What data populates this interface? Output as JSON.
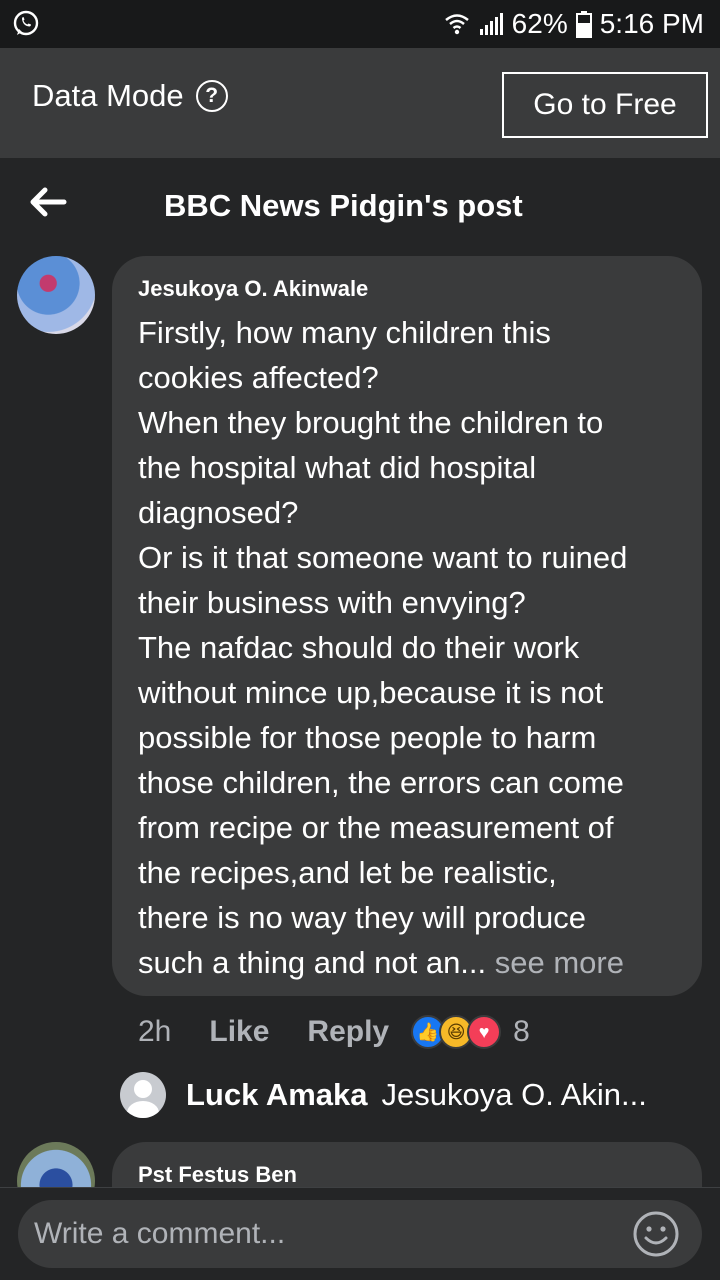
{
  "status_bar": {
    "battery": "62%",
    "time": "5:16 PM"
  },
  "data_bar": {
    "label": "Data Mode",
    "help_glyph": "?",
    "button": "Go to Free"
  },
  "header": {
    "title": "BBC News Pidgin's post"
  },
  "comment": {
    "author": "Jesukoya O. Akinwale",
    "text": "Firstly, how many children this\ncookies affected?\nWhen they brought the children to\nthe hospital what did hospital\ndiagnosed?\nOr is it that someone want to ruined\ntheir business with envying?\nThe nafdac should do their work\nwithout mince up,because it is not\npossible for those people to harm\nthose children, the errors can come\nfrom recipe or the measurement of\nthe recipes,and let be realistic,\nthere is no way they will produce\nsuch a thing and not  an...",
    "see_more": " see more",
    "time": "2h",
    "like": "Like",
    "reply": "Reply",
    "reactions_count": "8",
    "reactions": [
      "like",
      "haha",
      "love"
    ]
  },
  "reply_preview": {
    "name": "Luck Amaka",
    "text": "Jesukoya O. Akin..."
  },
  "comment2": {
    "author": "Pst Festus Ben"
  },
  "composer": {
    "placeholder": "Write a comment..."
  }
}
